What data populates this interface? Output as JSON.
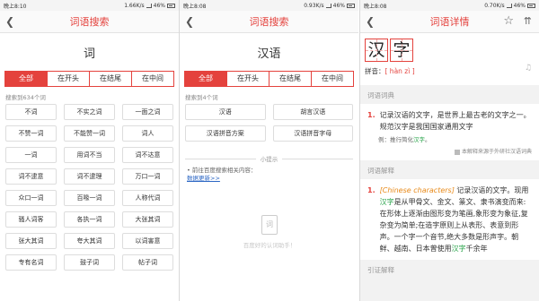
{
  "screens": [
    {
      "status": {
        "time": "晚上8:10",
        "speed": "1.66K/s",
        "battery": "46%"
      },
      "title": "词语搜索",
      "query": "词",
      "tabs": [
        "全部",
        "在开头",
        "在结尾",
        "在中间"
      ],
      "count": "搜索到634个词",
      "words": [
        "不词",
        "不实之词",
        "一面之词",
        "不赞一词",
        "不能赞一词",
        "词人",
        "一词",
        "用词不当",
        "词不达意",
        "词不逮意",
        "词不逮理",
        "万口一词",
        "众口一词",
        "百喙一词",
        "人称代词",
        "骚人词客",
        "各执一词",
        "大张其词",
        "张大其词",
        "夸大其词",
        "以词害意",
        "专有名词",
        "鼓子词",
        "帖子词"
      ]
    },
    {
      "status": {
        "time": "晚上8:08",
        "speed": "0.93K/s",
        "battery": "46%"
      },
      "title": "词语搜索",
      "query": "汉语",
      "tabs": [
        "全部",
        "在开头",
        "在结尾",
        "在中间"
      ],
      "count": "搜索到4个词",
      "words": [
        "汉语",
        "胡言汉语",
        "汉语拼音方案",
        "汉语拼音字母"
      ],
      "tip_title": "小提示",
      "tip_text": "前往百度搜索相关内容：",
      "tip_link": "数据更新>>",
      "empty_text": "百度好的认词助手！"
    },
    {
      "status": {
        "time": "晚上8:08",
        "speed": "0.70K/s",
        "battery": "46%"
      },
      "title": "词语详情",
      "chars": [
        "汉",
        "字"
      ],
      "pinyin_label": "拼音：",
      "pinyin": "[ hàn zì ]",
      "sections": [
        {
          "title": "词语词典",
          "def_num": "1.",
          "def_text": "记录汉语的文字，是世界上最古老的文字之一。规范汉字是我国国家通用文字",
          "example_label": "例：推行简化",
          "example_word": "汉字",
          "example_end": "。",
          "source": "本解释来源于外研社汉语词典"
        },
        {
          "title": "词语解释",
          "def_num": "1.",
          "def_en": "[Chinese characters]",
          "def_part1": " 记录汉语的文字。现用",
          "def_hl1": "汉字",
          "def_part2": "是从甲骨文、金文、篆文、隶书演变而来:在形体上逐渐由图形变为笔画,象形变为象征,复杂变为简单;在造字原则上从表形、表意到形声。一个字一个音节,绝大多数是形声字。朝鲜、越南、日本曾使用",
          "def_hl2": "汉字",
          "def_part3": "千余年"
        }
      ],
      "more_title": "引证解释"
    }
  ]
}
